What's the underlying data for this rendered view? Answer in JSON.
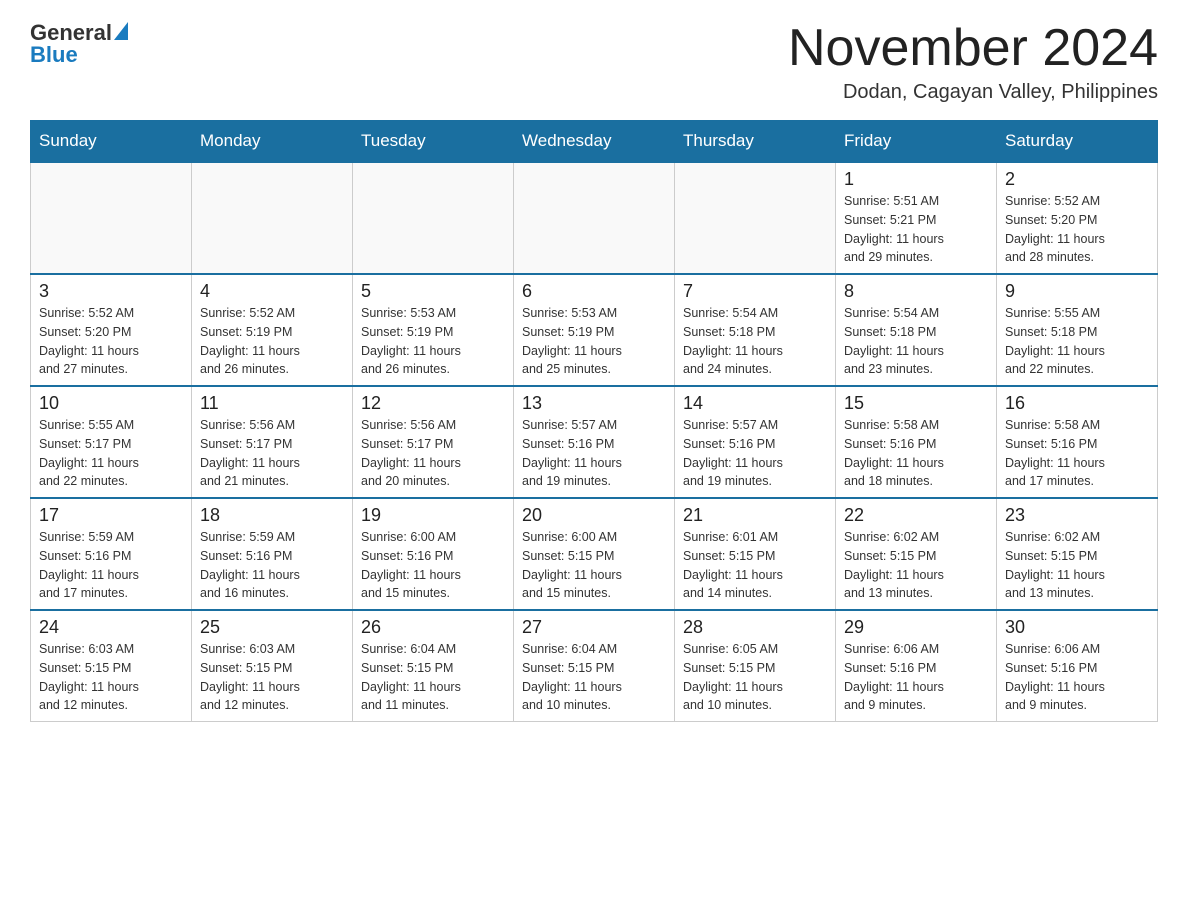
{
  "header": {
    "logo_general": "General",
    "logo_blue": "Blue",
    "title": "November 2024",
    "subtitle": "Dodan, Cagayan Valley, Philippines"
  },
  "days_of_week": [
    "Sunday",
    "Monday",
    "Tuesday",
    "Wednesday",
    "Thursday",
    "Friday",
    "Saturday"
  ],
  "weeks": [
    [
      {
        "day": "",
        "info": ""
      },
      {
        "day": "",
        "info": ""
      },
      {
        "day": "",
        "info": ""
      },
      {
        "day": "",
        "info": ""
      },
      {
        "day": "",
        "info": ""
      },
      {
        "day": "1",
        "info": "Sunrise: 5:51 AM\nSunset: 5:21 PM\nDaylight: 11 hours\nand 29 minutes."
      },
      {
        "day": "2",
        "info": "Sunrise: 5:52 AM\nSunset: 5:20 PM\nDaylight: 11 hours\nand 28 minutes."
      }
    ],
    [
      {
        "day": "3",
        "info": "Sunrise: 5:52 AM\nSunset: 5:20 PM\nDaylight: 11 hours\nand 27 minutes."
      },
      {
        "day": "4",
        "info": "Sunrise: 5:52 AM\nSunset: 5:19 PM\nDaylight: 11 hours\nand 26 minutes."
      },
      {
        "day": "5",
        "info": "Sunrise: 5:53 AM\nSunset: 5:19 PM\nDaylight: 11 hours\nand 26 minutes."
      },
      {
        "day": "6",
        "info": "Sunrise: 5:53 AM\nSunset: 5:19 PM\nDaylight: 11 hours\nand 25 minutes."
      },
      {
        "day": "7",
        "info": "Sunrise: 5:54 AM\nSunset: 5:18 PM\nDaylight: 11 hours\nand 24 minutes."
      },
      {
        "day": "8",
        "info": "Sunrise: 5:54 AM\nSunset: 5:18 PM\nDaylight: 11 hours\nand 23 minutes."
      },
      {
        "day": "9",
        "info": "Sunrise: 5:55 AM\nSunset: 5:18 PM\nDaylight: 11 hours\nand 22 minutes."
      }
    ],
    [
      {
        "day": "10",
        "info": "Sunrise: 5:55 AM\nSunset: 5:17 PM\nDaylight: 11 hours\nand 22 minutes."
      },
      {
        "day": "11",
        "info": "Sunrise: 5:56 AM\nSunset: 5:17 PM\nDaylight: 11 hours\nand 21 minutes."
      },
      {
        "day": "12",
        "info": "Sunrise: 5:56 AM\nSunset: 5:17 PM\nDaylight: 11 hours\nand 20 minutes."
      },
      {
        "day": "13",
        "info": "Sunrise: 5:57 AM\nSunset: 5:16 PM\nDaylight: 11 hours\nand 19 minutes."
      },
      {
        "day": "14",
        "info": "Sunrise: 5:57 AM\nSunset: 5:16 PM\nDaylight: 11 hours\nand 19 minutes."
      },
      {
        "day": "15",
        "info": "Sunrise: 5:58 AM\nSunset: 5:16 PM\nDaylight: 11 hours\nand 18 minutes."
      },
      {
        "day": "16",
        "info": "Sunrise: 5:58 AM\nSunset: 5:16 PM\nDaylight: 11 hours\nand 17 minutes."
      }
    ],
    [
      {
        "day": "17",
        "info": "Sunrise: 5:59 AM\nSunset: 5:16 PM\nDaylight: 11 hours\nand 17 minutes."
      },
      {
        "day": "18",
        "info": "Sunrise: 5:59 AM\nSunset: 5:16 PM\nDaylight: 11 hours\nand 16 minutes."
      },
      {
        "day": "19",
        "info": "Sunrise: 6:00 AM\nSunset: 5:16 PM\nDaylight: 11 hours\nand 15 minutes."
      },
      {
        "day": "20",
        "info": "Sunrise: 6:00 AM\nSunset: 5:15 PM\nDaylight: 11 hours\nand 15 minutes."
      },
      {
        "day": "21",
        "info": "Sunrise: 6:01 AM\nSunset: 5:15 PM\nDaylight: 11 hours\nand 14 minutes."
      },
      {
        "day": "22",
        "info": "Sunrise: 6:02 AM\nSunset: 5:15 PM\nDaylight: 11 hours\nand 13 minutes."
      },
      {
        "day": "23",
        "info": "Sunrise: 6:02 AM\nSunset: 5:15 PM\nDaylight: 11 hours\nand 13 minutes."
      }
    ],
    [
      {
        "day": "24",
        "info": "Sunrise: 6:03 AM\nSunset: 5:15 PM\nDaylight: 11 hours\nand 12 minutes."
      },
      {
        "day": "25",
        "info": "Sunrise: 6:03 AM\nSunset: 5:15 PM\nDaylight: 11 hours\nand 12 minutes."
      },
      {
        "day": "26",
        "info": "Sunrise: 6:04 AM\nSunset: 5:15 PM\nDaylight: 11 hours\nand 11 minutes."
      },
      {
        "day": "27",
        "info": "Sunrise: 6:04 AM\nSunset: 5:15 PM\nDaylight: 11 hours\nand 10 minutes."
      },
      {
        "day": "28",
        "info": "Sunrise: 6:05 AM\nSunset: 5:15 PM\nDaylight: 11 hours\nand 10 minutes."
      },
      {
        "day": "29",
        "info": "Sunrise: 6:06 AM\nSunset: 5:16 PM\nDaylight: 11 hours\nand 9 minutes."
      },
      {
        "day": "30",
        "info": "Sunrise: 6:06 AM\nSunset: 5:16 PM\nDaylight: 11 hours\nand 9 minutes."
      }
    ]
  ]
}
